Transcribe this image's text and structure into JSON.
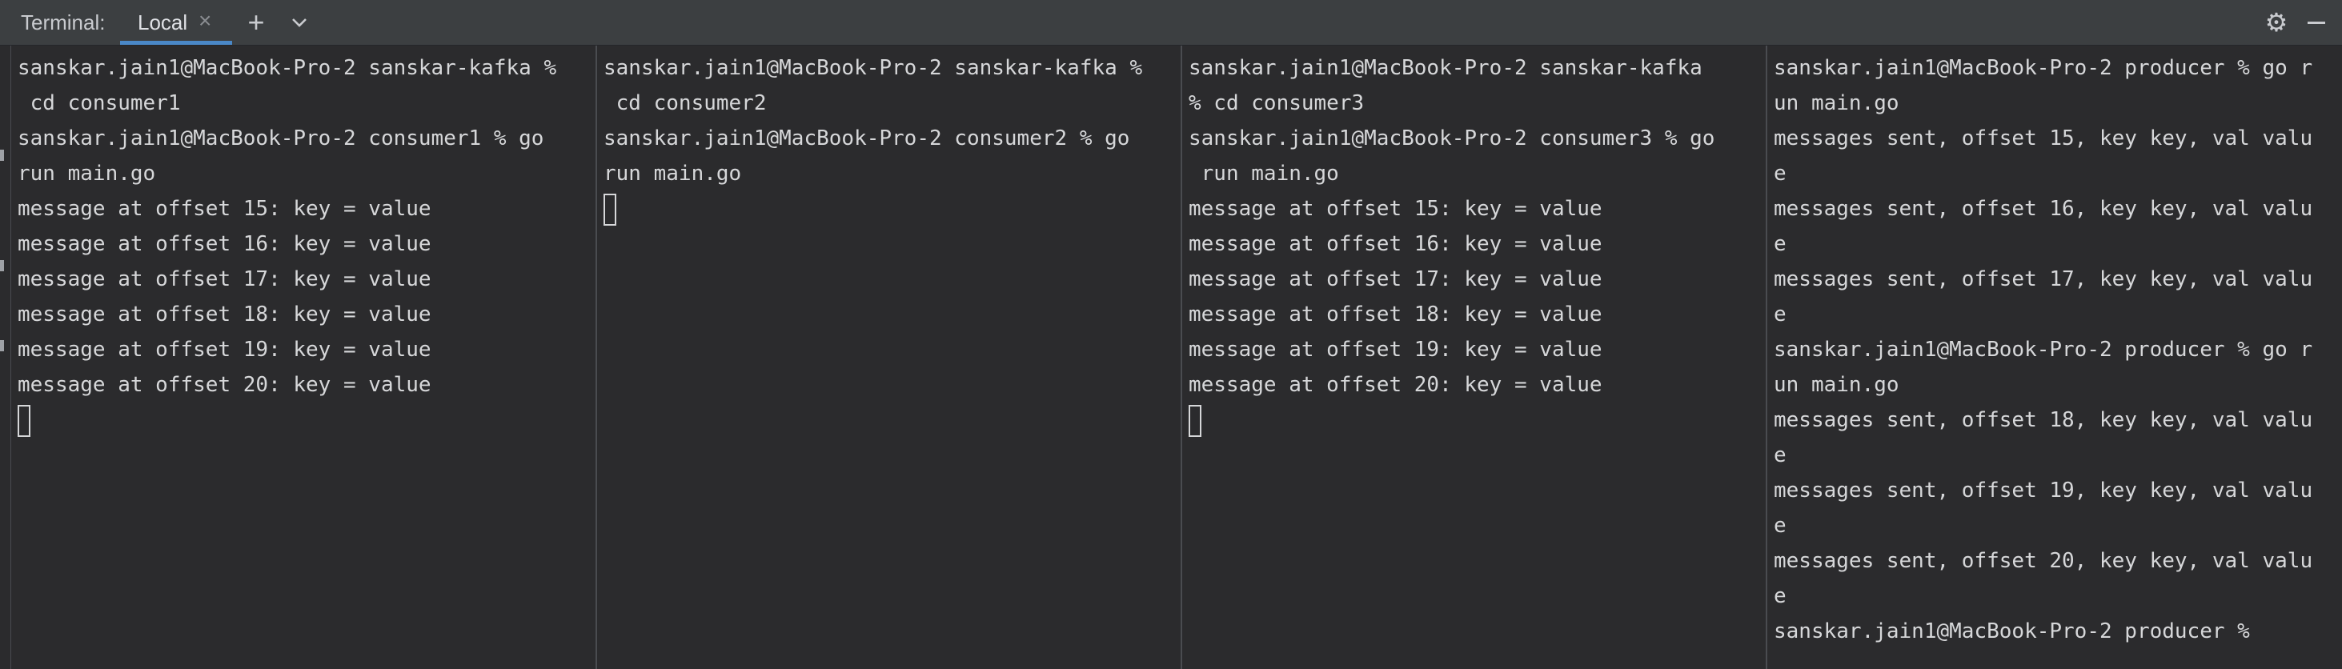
{
  "tabbar": {
    "title": "Terminal:",
    "tab_label": "Local",
    "close_glyph": "×",
    "plus_glyph": "+",
    "gear_glyph": "⚙"
  },
  "panes": [
    {
      "lines": [
        "sanskar.jain1@MacBook-Pro-2 sanskar-kafka %",
        " cd consumer1",
        "sanskar.jain1@MacBook-Pro-2 consumer1 % go",
        "run main.go",
        "message at offset 15: key = value",
        "message at offset 16: key = value",
        "message at offset 17: key = value",
        "message at offset 18: key = value",
        "message at offset 19: key = value",
        "message at offset 20: key = value"
      ],
      "cursor": true
    },
    {
      "lines": [
        "sanskar.jain1@MacBook-Pro-2 sanskar-kafka %",
        " cd consumer2",
        "sanskar.jain1@MacBook-Pro-2 consumer2 % go",
        "run main.go"
      ],
      "cursor": true
    },
    {
      "lines": [
        "sanskar.jain1@MacBook-Pro-2 sanskar-kafka",
        "% cd consumer3",
        "sanskar.jain1@MacBook-Pro-2 consumer3 % go",
        " run main.go",
        "message at offset 15: key = value",
        "message at offset 16: key = value",
        "message at offset 17: key = value",
        "message at offset 18: key = value",
        "message at offset 19: key = value",
        "message at offset 20: key = value"
      ],
      "cursor": true
    },
    {
      "lines": [
        "sanskar.jain1@MacBook-Pro-2 producer % go r",
        "un main.go",
        "messages sent, offset 15, key key, val valu",
        "e",
        "messages sent, offset 16, key key, val valu",
        "e",
        "messages sent, offset 17, key key, val valu",
        "e",
        "sanskar.jain1@MacBook-Pro-2 producer % go r",
        "un main.go",
        "messages sent, offset 18, key key, val valu",
        "e",
        "messages sent, offset 19, key key, val valu",
        "e",
        "messages sent, offset 20, key key, val valu",
        "e",
        "sanskar.jain1@MacBook-Pro-2 producer %"
      ],
      "cursor": false
    }
  ]
}
